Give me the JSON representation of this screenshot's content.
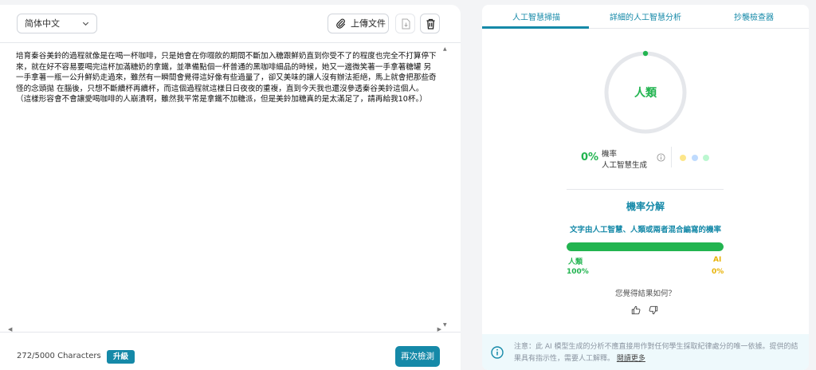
{
  "editor": {
    "language": "简体中文",
    "upload_label": "上傳文件",
    "text": "培育秦谷美鈴的過程就像是在喝一杯咖啡，只是她會在你啜飲的期間不斷加入糖跟鮮奶直到你受不了的程度也完全不打算停下來，就在好不容易要喝完這杯加滿糖奶的拿鐵，並準備點個一杯普通的黑咖啡細品的時候，她又一邊微笑著一手拿著糖罐 另一手拿著一瓶一公升鮮奶走過來，雖然有一瞬間會覺得這好像有些過量了，卻又美味的讓人沒有辦法拒絕，馬上就會把那些奇怪的念頭拋 在腦後，只想不斷續杯再續杯，而這個過程就這樣日日夜夜的重複，直到今天我也還沒參透秦谷美鈴這個人。 （這樣形容會不會讓愛喝咖啡的人崩潰啊，雖然我平常是拿鐵不加糖派，但是美鈴加糖真的是太滿足了，請再給我10杯。）",
    "char_count": "272/5000 Characters",
    "upgrade_label": "升級",
    "recheck_label": "再次檢測"
  },
  "tabs": [
    {
      "label": "人工智慧掃描",
      "active": true
    },
    {
      "label": "詳細的人工智慧分析",
      "active": false
    },
    {
      "label": "抄襲檢查器",
      "active": false
    }
  ],
  "result": {
    "verdict": "人類",
    "ai_probability": 0,
    "ai_probability_label": "0%",
    "prob_label_line1": "機率",
    "prob_label_line2": "人工智慧生成",
    "dots": [
      "#fde68a",
      "#bfdbfe",
      "#bbf7d0"
    ],
    "accent_color": "#22b450"
  },
  "breakdown": {
    "title": "機率分解",
    "subtitle": "文字由人工智慧、人類或兩者混合編寫的機率",
    "human_label": "人類",
    "human_pct_label": "100%",
    "human_fraction": 1.0,
    "ai_label": "AI",
    "ai_pct_label": "0%"
  },
  "feedback": {
    "question": "您覺得結果如何？"
  },
  "notice": {
    "text": "注意：此 AI 模型生成的分析不應直接用作對任何學生採取紀律處分的唯一依據。提供的結果具有指示性，需要人工解釋。",
    "link": "閱讀更多"
  }
}
